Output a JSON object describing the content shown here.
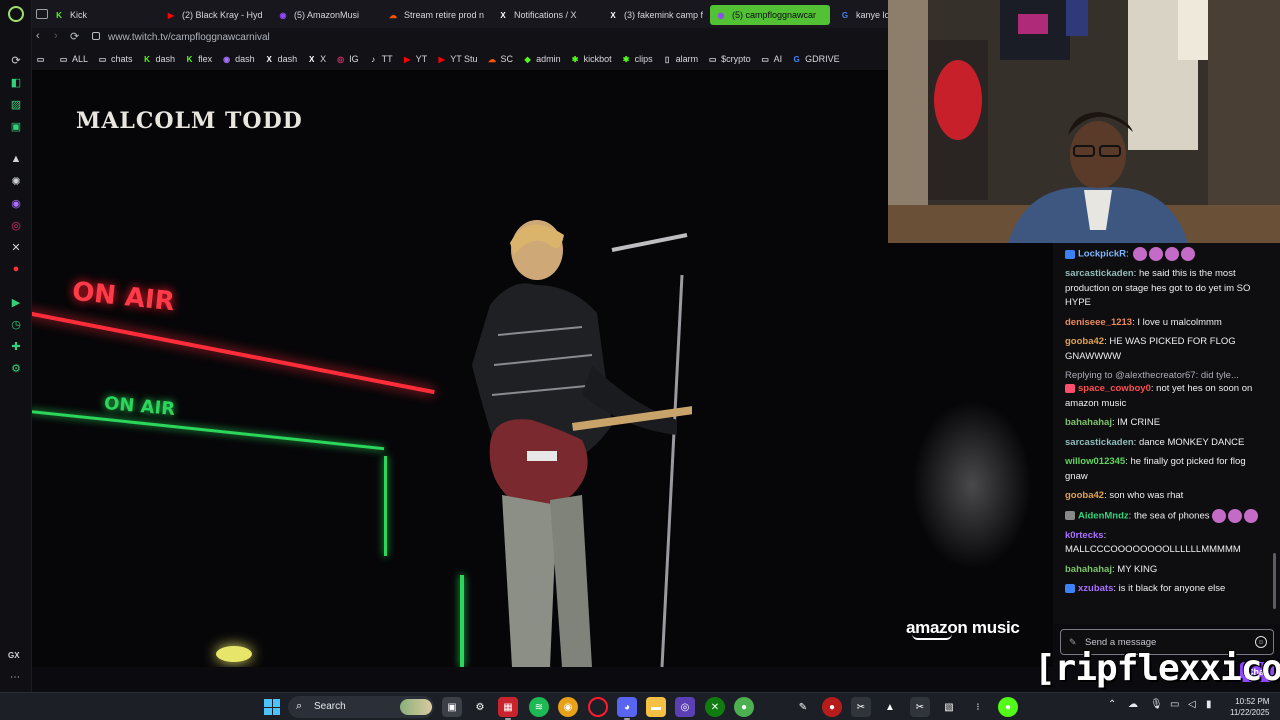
{
  "browser": {
    "tabs": [
      {
        "label": "Kick",
        "icon_color": "#53fc18",
        "icon_char": "K"
      },
      {
        "label": "(2) Black Kray - Hyd",
        "icon_color": "#ff0000",
        "icon_char": "▶"
      },
      {
        "label": "(5) AmazonMusi",
        "icon_color": "#9146ff",
        "icon_char": "◉"
      },
      {
        "label": "Stream retire prod n",
        "icon_color": "#ff5500",
        "icon_char": "☁"
      },
      {
        "label": "Notifications / X",
        "icon_color": "#ffffff",
        "icon_char": "X"
      },
      {
        "label": "(3) fakemink camp f",
        "icon_color": "#ffffff",
        "icon_char": "X"
      },
      {
        "label": "(5) campfloggnawcar",
        "icon_color": "#9146ff",
        "icon_char": "◉"
      },
      {
        "label": "kanye lo",
        "icon_color": "#4285f4",
        "icon_char": "G"
      }
    ],
    "url": "www.twitch.tv/campfloggnawcarnival",
    "bookmarks": [
      {
        "label": "",
        "icon": "folder-icon",
        "char": "▭",
        "color": "#cfd3d8"
      },
      {
        "label": "ALL",
        "icon": "folder-icon",
        "char": "▭",
        "color": "#cfd3d8"
      },
      {
        "label": "chats",
        "icon": "folder-icon",
        "char": "▭",
        "color": "#cfd3d8"
      },
      {
        "label": "dash",
        "icon": "kick-icon",
        "char": "K",
        "color": "#53fc18"
      },
      {
        "label": "flex",
        "icon": "kick-icon",
        "char": "K",
        "color": "#53fc18"
      },
      {
        "label": "dash",
        "icon": "twitch-icon",
        "char": "◉",
        "color": "#a970ff"
      },
      {
        "label": "dash",
        "icon": "x-icon",
        "char": "X",
        "color": "#ffffff"
      },
      {
        "label": "X",
        "icon": "x-icon",
        "char": "X",
        "color": "#ffffff"
      },
      {
        "label": "IG",
        "icon": "instagram-icon",
        "char": "◎",
        "color": "#e1306c"
      },
      {
        "label": "TT",
        "icon": "tiktok-icon",
        "char": "♪",
        "color": "#ffffff"
      },
      {
        "label": "YT",
        "icon": "youtube-icon",
        "char": "▶",
        "color": "#ff0000"
      },
      {
        "label": "YT Stu",
        "icon": "youtube-icon",
        "char": "▶",
        "color": "#ff0000"
      },
      {
        "label": "SC",
        "icon": "soundcloud-icon",
        "char": "☁",
        "color": "#ff5500"
      },
      {
        "label": "admin",
        "icon": "shield-icon",
        "char": "◆",
        "color": "#53fc18"
      },
      {
        "label": "kickbot",
        "icon": "bot-icon",
        "char": "✱",
        "color": "#53fc18"
      },
      {
        "label": "clips",
        "icon": "clips-icon",
        "char": "✱",
        "color": "#53fc18"
      },
      {
        "label": "alarm",
        "icon": "document-icon",
        "char": "▯",
        "color": "#cfd3d8"
      },
      {
        "label": "$crypto",
        "icon": "folder-icon",
        "char": "▭",
        "color": "#cfd3d8"
      },
      {
        "label": "AI",
        "icon": "folder-icon",
        "char": "▭",
        "color": "#cfd3d8"
      },
      {
        "label": "GDRIVE",
        "icon": "google-icon",
        "char": "G",
        "color": "#4285f4"
      }
    ]
  },
  "stream": {
    "title_overlay": "MALCOLM TODD",
    "sign_red": "ON AIR",
    "sign_green": "ON AIR",
    "brand": "amazon music"
  },
  "chat": {
    "messages": [
      {
        "user": "LockpickR",
        "color": "#7fb6ff",
        "text": "",
        "badge": "#3b82f6",
        "emotes": 4
      },
      {
        "user": "sarcastickaden",
        "color": "#8fbcbb",
        "text": "he said this is the most production on stage hes got to do yet im SO HYPE"
      },
      {
        "user": "deniseee_1213",
        "color": "#e98a5e",
        "text": "I love u malcolmmm"
      },
      {
        "user": "gooba42",
        "color": "#e0a050",
        "text": "HE WAS PICKED FOR FLOG GNAWWWW"
      },
      {
        "user": "space_cowboy0",
        "color": "#ff4d4d",
        "text": "not yet hes on soon on amazon music",
        "reply": "Replying to @alexthecreator67: did tyle...",
        "badge": "#ff4d6d"
      },
      {
        "user": "bahahahaj",
        "color": "#7cc36a",
        "text": "IM CRINE"
      },
      {
        "user": "sarcastickaden",
        "color": "#8fbcbb",
        "text": "dance MONKEY DANCE"
      },
      {
        "user": "willow012345",
        "color": "#5cd65c",
        "text": "he finally got picked for flog gnaw"
      },
      {
        "user": "gooba42",
        "color": "#e0a050",
        "text": "son who was rhat"
      },
      {
        "user": "AidenMndz",
        "color": "#33d17a",
        "text": "the sea of phones",
        "badge": "#888888",
        "emotes": 3
      },
      {
        "user": "k0rtecks",
        "color": "#a970ff",
        "text": "MALLCCCOOOOOOOOLLLLLLMMMMM"
      },
      {
        "user": "bahahahaj",
        "color": "#7cc36a",
        "text": "MY KING"
      },
      {
        "user": "xzubats",
        "color": "#a970ff",
        "text": "is it black for anyone else",
        "badge": "#3b82f6"
      }
    ],
    "input_placeholder": "Send a message",
    "chat_button": "Chat"
  },
  "streamer_overlay": "[ripflexxico]",
  "taskbar": {
    "search_label": "Search",
    "time": "10:52 PM",
    "date": "11/22/2025"
  },
  "sidebar": {
    "gx_label": "GX"
  }
}
